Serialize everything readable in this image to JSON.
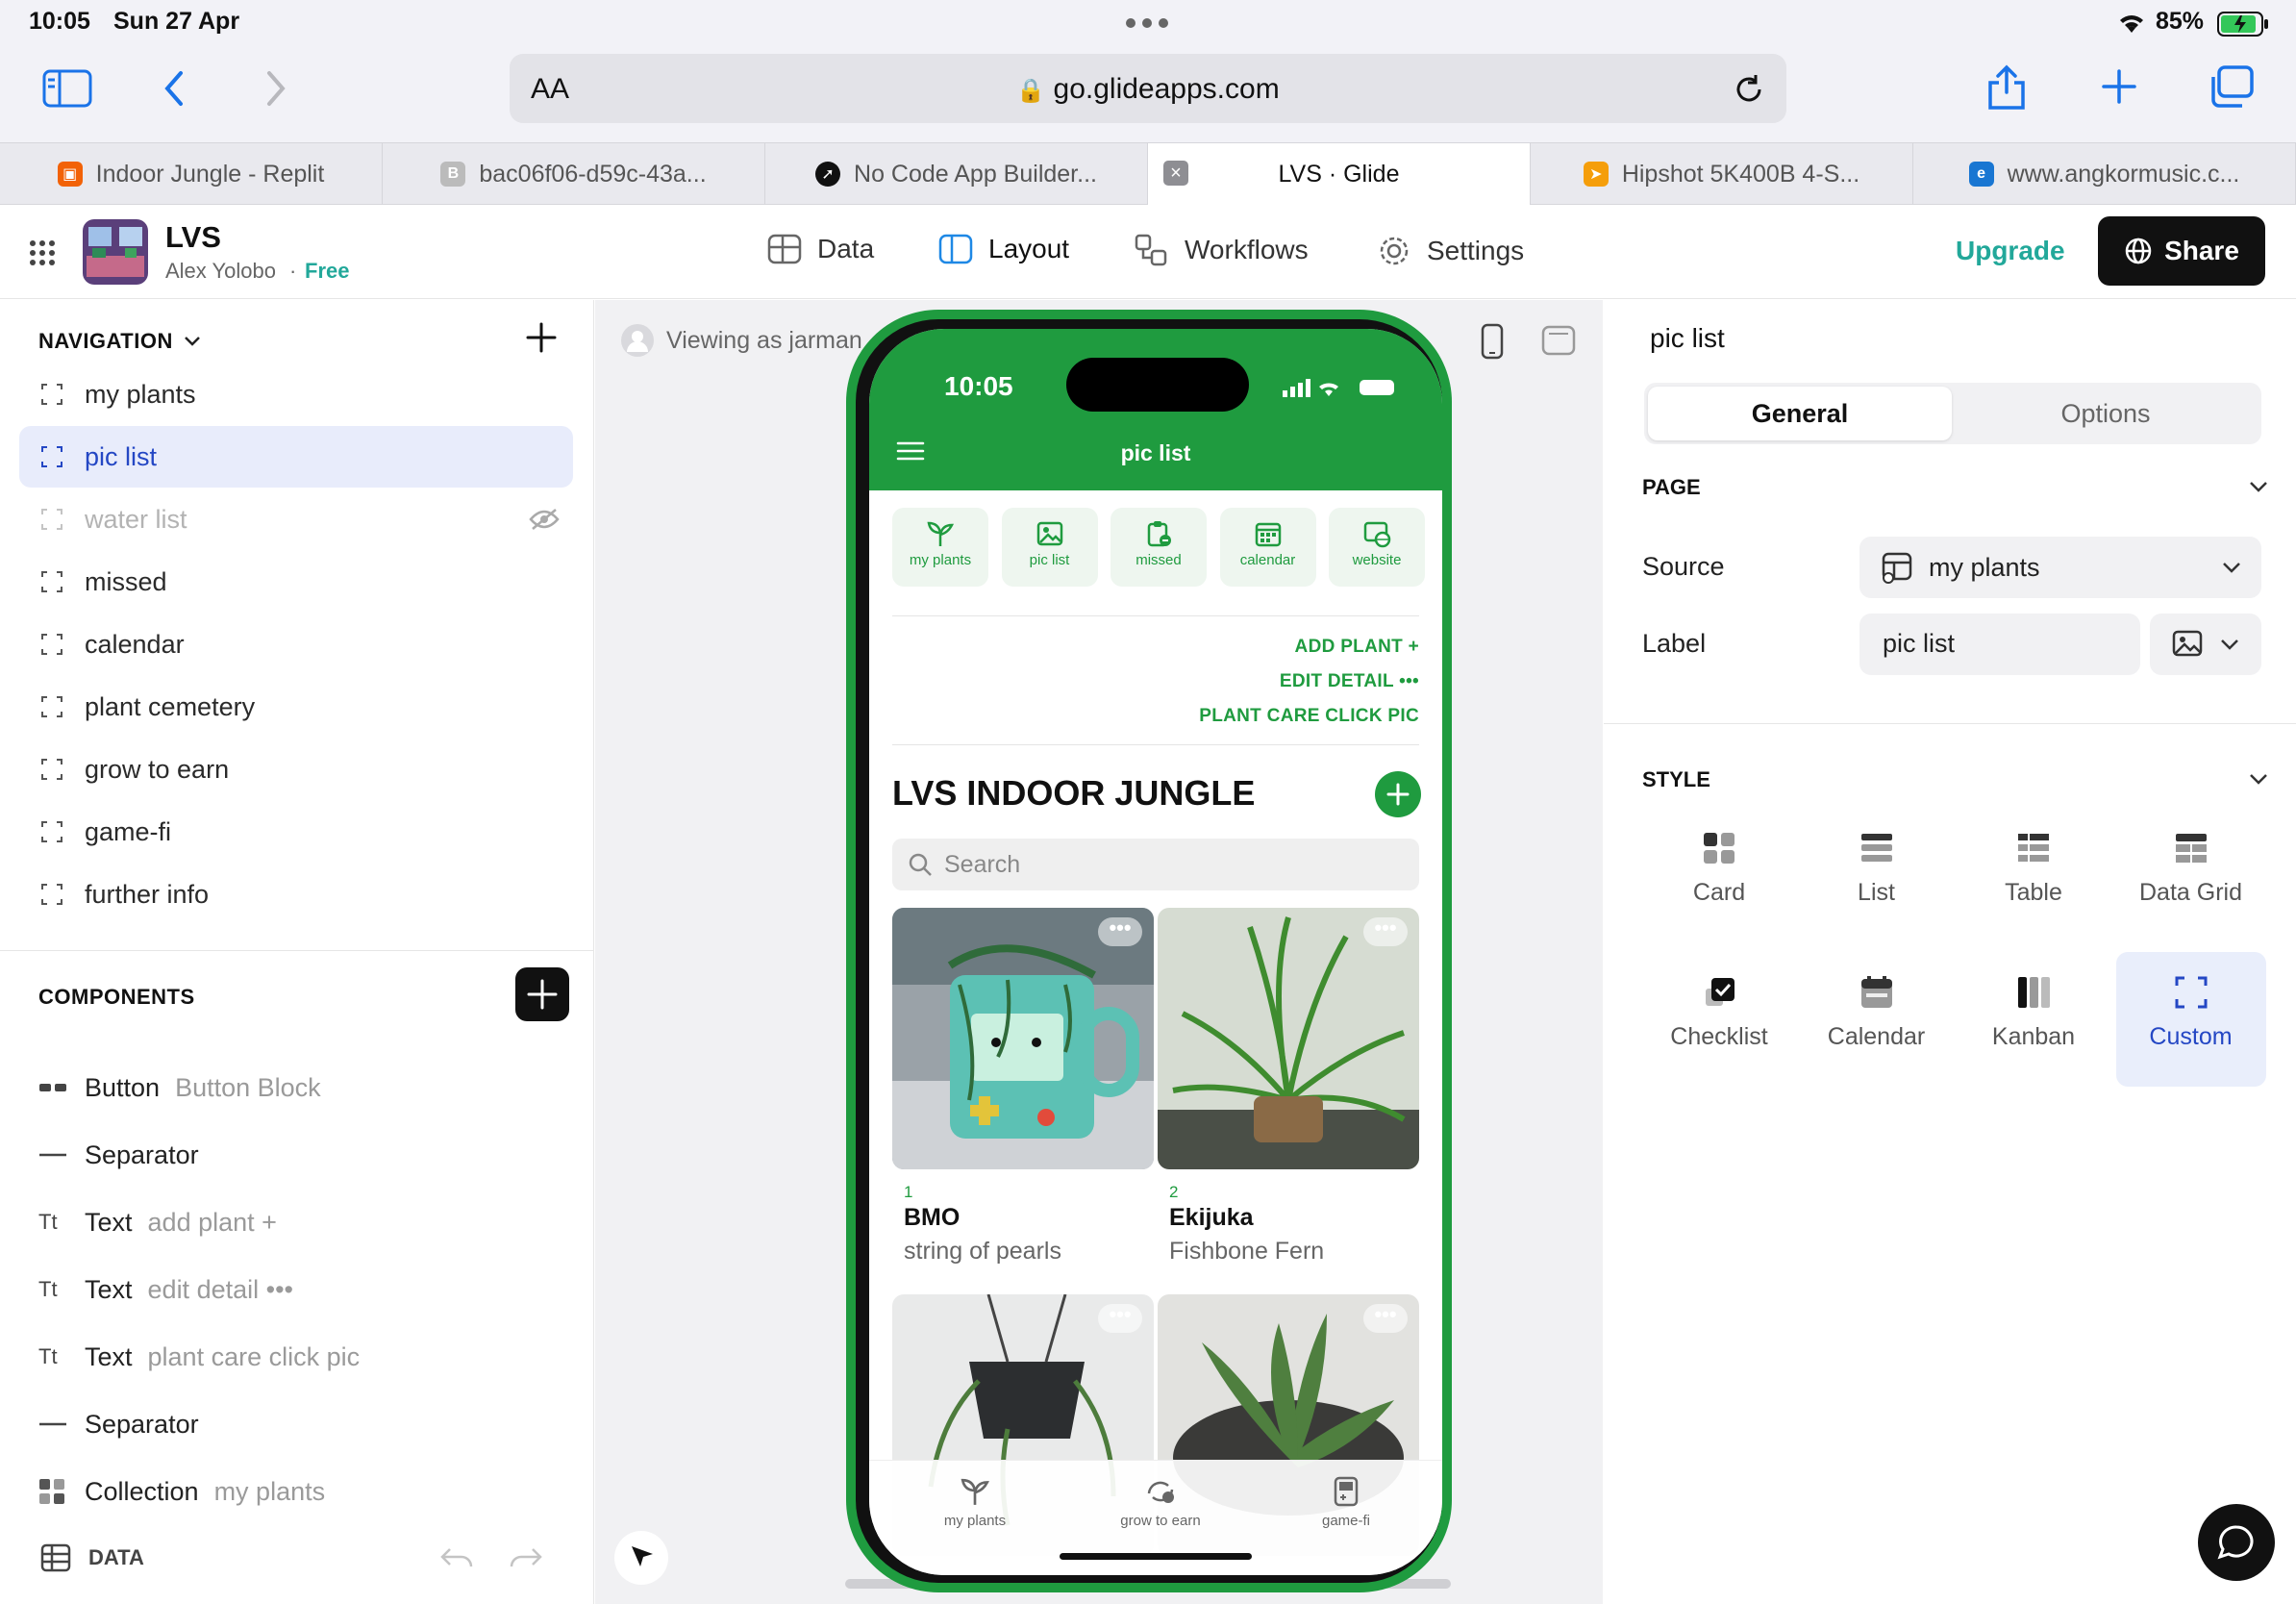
{
  "status_bar": {
    "time": "10:05",
    "date": "Sun 27 Apr",
    "battery": "85%"
  },
  "browser": {
    "text_size": "AA",
    "url": "go.glideapps.com",
    "tabs": [
      {
        "title": "Indoor Jungle - Replit",
        "active": false
      },
      {
        "title": "bac06f06-d59c-43a...",
        "active": false
      },
      {
        "title": "No Code App Builder...",
        "active": false
      },
      {
        "title": "LVS · Glide",
        "active": true
      },
      {
        "title": "Hipshot 5K400B 4-S...",
        "active": false
      },
      {
        "title": "www.angkormusic.c...",
        "active": false
      }
    ]
  },
  "app": {
    "name": "LVS",
    "owner": "Alex Yolobo",
    "plan": "Free",
    "menu": [
      "Data",
      "Layout",
      "Workflows",
      "Settings"
    ],
    "upgrade": "Upgrade",
    "share": "Share",
    "accent": "#2bb3a3"
  },
  "navigation": {
    "header": "NAVIGATION",
    "items": [
      {
        "label": "my plants"
      },
      {
        "label": "pic list"
      },
      {
        "label": "water list"
      },
      {
        "label": "missed"
      },
      {
        "label": "calendar"
      },
      {
        "label": "plant cemetery"
      },
      {
        "label": "grow to earn"
      },
      {
        "label": "game-fi"
      },
      {
        "label": "further info"
      }
    ]
  },
  "components": {
    "header": "COMPONENTS",
    "items": [
      {
        "type": "Button",
        "detail": "Button Block"
      },
      {
        "type": "Separator",
        "detail": ""
      },
      {
        "type": "Text",
        "detail": "add plant +"
      },
      {
        "type": "Text",
        "detail": "edit detail •••"
      },
      {
        "type": "Text",
        "detail": "plant care click pic"
      },
      {
        "type": "Separator",
        "detail": ""
      },
      {
        "type": "Collection",
        "detail": "my plants"
      }
    ],
    "data_label": "DATA"
  },
  "canvas": {
    "viewing_as": "Viewing as jarman"
  },
  "phone": {
    "time": "10:05",
    "title": "pic list",
    "quick_links": [
      "my plants",
      "pic list",
      "missed",
      "calendar",
      "website"
    ],
    "links": [
      "ADD PLANT +",
      "EDIT DETAIL •••",
      "PLANT CARE CLICK PIC"
    ],
    "collection_title": "LVS INDOOR JUNGLE",
    "search_placeholder": "Search",
    "cards": [
      {
        "index": "1",
        "name": "BMO",
        "type": "string of pearls"
      },
      {
        "index": "2",
        "name": "Ekijuka",
        "type": "Fishbone Fern"
      }
    ],
    "bottom_tabs": [
      "my plants",
      "grow to earn",
      "game-fi"
    ],
    "brand_color": "#1f9b3f"
  },
  "right_panel": {
    "title": "pic list",
    "tabs": [
      "General",
      "Options"
    ],
    "page_header": "PAGE",
    "source_label": "Source",
    "source_value": "my plants",
    "label_label": "Label",
    "label_value": "pic list",
    "style_header": "STYLE",
    "styles": [
      "Card",
      "List",
      "Table",
      "Data Grid",
      "Checklist",
      "Calendar",
      "Kanban",
      "Custom"
    ],
    "selected_style": "Custom"
  }
}
